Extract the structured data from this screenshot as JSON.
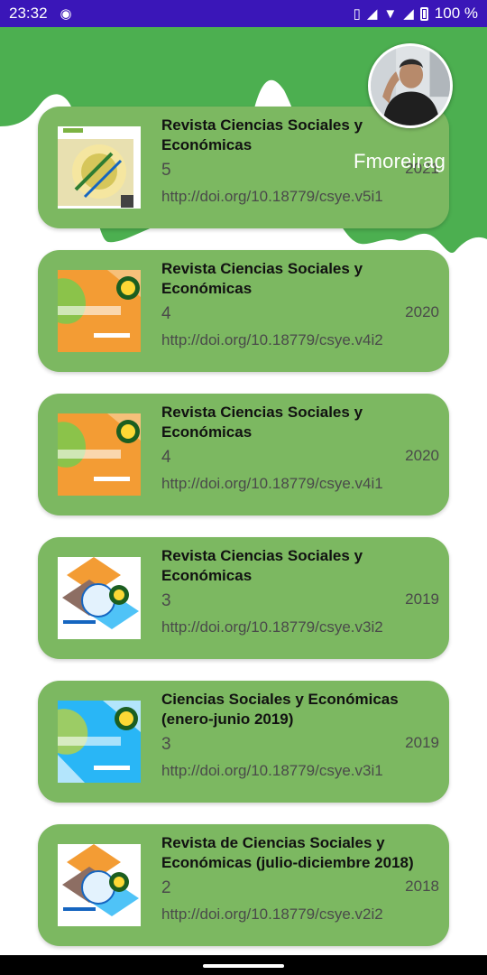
{
  "status_bar": {
    "time": "23:32",
    "notification_icon": "game-controller-icon",
    "right_icons": [
      "vibrate-icon",
      "signal-icon",
      "wifi-icon",
      "no-sim-icon",
      "battery-icon"
    ],
    "battery": "100 %"
  },
  "user": {
    "name": "Fmoreirag",
    "avatar_icon": "profile-photo"
  },
  "colors": {
    "status_bar": "#3a16b8",
    "header_green": "#4caf50",
    "card_green": "#7cb861"
  },
  "issues": [
    {
      "title": "Revista Ciencias Sociales y Económicas",
      "volume": "5",
      "year": "2021",
      "doi": "http://doi.org/10.18779/csye.v5i1"
    },
    {
      "title": "Revista Ciencias Sociales y Económicas",
      "volume": "4",
      "year": "2020",
      "doi": "http://doi.org/10.18779/csye.v4i2"
    },
    {
      "title": "Revista Ciencias Sociales y Económicas",
      "volume": "4",
      "year": "2020",
      "doi": "http://doi.org/10.18779/csye.v4i1"
    },
    {
      "title": "Revista Ciencias Sociales y Económicas",
      "volume": "3",
      "year": "2019",
      "doi": "http://doi.org/10.18779/csye.v3i2"
    },
    {
      "title": "Ciencias Sociales y Económicas (enero-junio 2019)",
      "volume": "3",
      "year": "2019",
      "doi": "http://doi.org/10.18779/csye.v3i1"
    },
    {
      "title": "Revista de Ciencias Sociales y Económicas (julio-diciembre 2018)",
      "volume": "2",
      "year": "2018",
      "doi": "http://doi.org/10.18779/csye.v2i2"
    }
  ]
}
